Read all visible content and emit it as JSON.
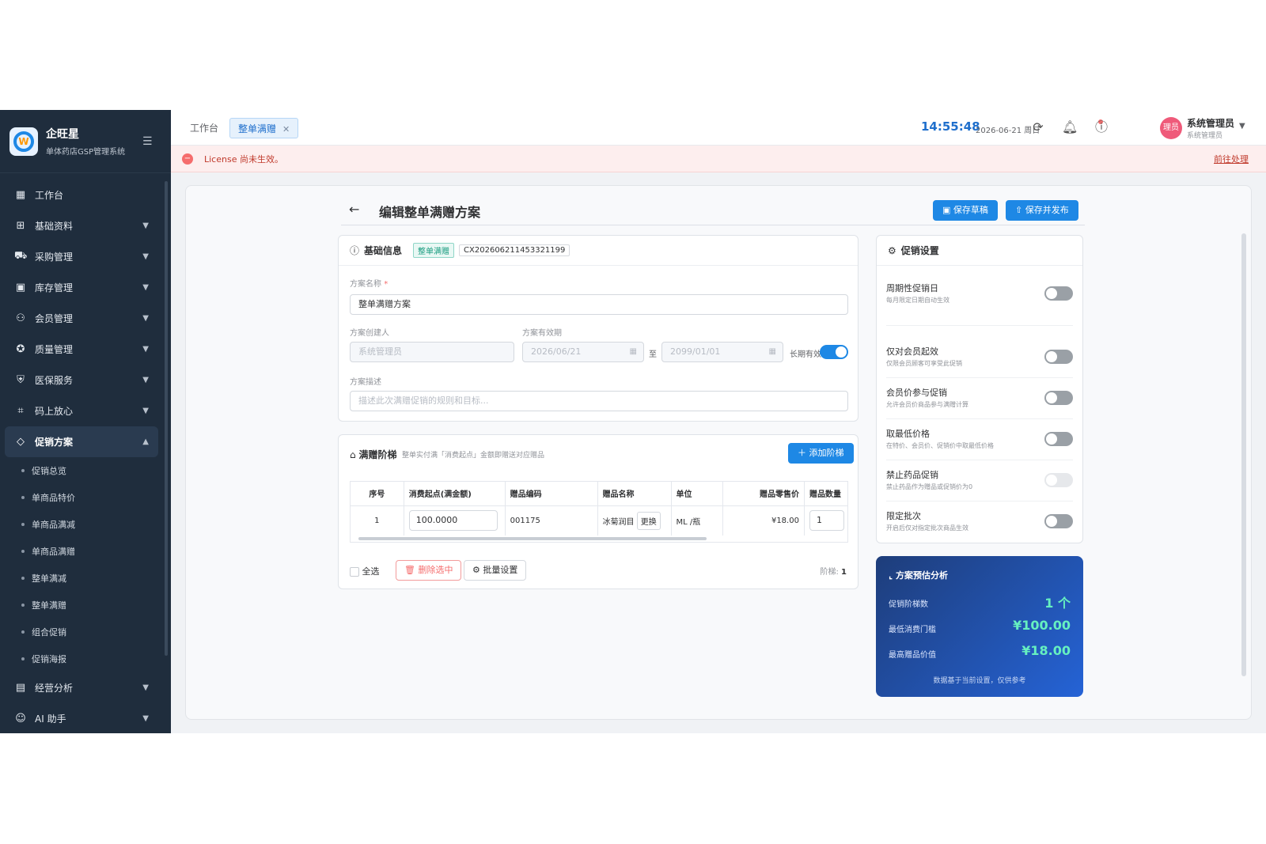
{
  "app": {
    "name": "企旺星",
    "subtitle": "单体药店GSP管理系统"
  },
  "sidebar": {
    "items": [
      {
        "label": "工作台",
        "icon": "dashboard-icon"
      },
      {
        "label": "基础资料",
        "icon": "grid-icon"
      },
      {
        "label": "采购管理",
        "icon": "cart-icon"
      },
      {
        "label": "库存管理",
        "icon": "inventory-icon"
      },
      {
        "label": "会员管理",
        "icon": "members-icon"
      },
      {
        "label": "质量管理",
        "icon": "quality-icon"
      },
      {
        "label": "医保服务",
        "icon": "shield-icon"
      },
      {
        "label": "码上放心",
        "icon": "qrcode-icon"
      },
      {
        "label": "促销方案",
        "icon": "tag-icon"
      },
      {
        "label": "经营分析",
        "icon": "analytics-icon"
      },
      {
        "label": "AI 助手",
        "icon": "robot-icon"
      }
    ],
    "sub_items": [
      "促销总览",
      "单商品特价",
      "单商品满减",
      "单商品满赠",
      "整单满减",
      "整单满赠",
      "组合促销",
      "促销海报"
    ]
  },
  "tabs": {
    "home": "工作台",
    "current": "整单满赠"
  },
  "header": {
    "time": "14:55:48",
    "date": "2026-06-21 周日",
    "user_name": "系统管理员",
    "user_role": "系统管理员",
    "avatar_text": "理员"
  },
  "license": {
    "message": "License 尚未生效。",
    "action": "前往处理"
  },
  "page": {
    "title": "编辑整单满赠方案",
    "save_draft": "保存草稿",
    "save_publish": "保存并发布"
  },
  "basic": {
    "title": "基础信息",
    "tag": "整单满赠",
    "code": "CX202606211453321199",
    "name_label": "方案名称",
    "name_value": "整单满赠方案",
    "creator_label": "方案创建人",
    "creator_value": "系统管理员",
    "period_label": "方案有效期",
    "start_date": "2026/06/21",
    "to": "至",
    "end_date": "2099/01/01",
    "long_term_label": "长期有效",
    "desc_label": "方案描述",
    "desc_placeholder": "描述此次满赠促销的规则和目标..."
  },
  "tiers": {
    "title": "满赠阶梯",
    "hint": "整单实付满「消费起点」金额即赠送对应赠品",
    "add_button": "添加阶梯",
    "columns": [
      "序号",
      "消费起点(满金额)",
      "赠品编码",
      "赠品名称",
      "单位",
      "赠品零售价",
      "赠品数量"
    ],
    "rows": [
      {
        "no": "1",
        "threshold": "100.0000",
        "code": "001175",
        "name": "冰菊润目",
        "replace": "更换",
        "unit": "ML /瓶",
        "price": "¥18.00",
        "qty": "1"
      }
    ],
    "select_all": "全选",
    "delete_selected": "删除选中",
    "batch_set": "批量设置",
    "count_label": "阶梯:",
    "count_value": "1"
  },
  "settings": {
    "title": "促销设置",
    "items": [
      {
        "title": "周期性促销日",
        "desc": "每月限定日期自动生效"
      },
      {
        "title": "仅对会员起效",
        "desc": "仅限会员顾客可享受此促销"
      },
      {
        "title": "会员价参与促销",
        "desc": "允许会员价商品参与满赠计算"
      },
      {
        "title": "取最低价格",
        "desc": "在特价、会员价、促销价中取最低价格"
      },
      {
        "title": "禁止药品促销",
        "desc": "禁止药品作为赠品或促销价为0"
      },
      {
        "title": "限定批次",
        "desc": "开启后仅对指定批次商品生效"
      }
    ]
  },
  "analysis": {
    "title": "方案预估分析",
    "rows": [
      {
        "label": "促销阶梯数",
        "value": "1 个"
      },
      {
        "label": "最低消费门槛",
        "value": "¥100.00"
      },
      {
        "label": "最高赠品价值",
        "value": "¥18.00"
      }
    ],
    "note": "数据基于当前设置，仅供参考"
  }
}
